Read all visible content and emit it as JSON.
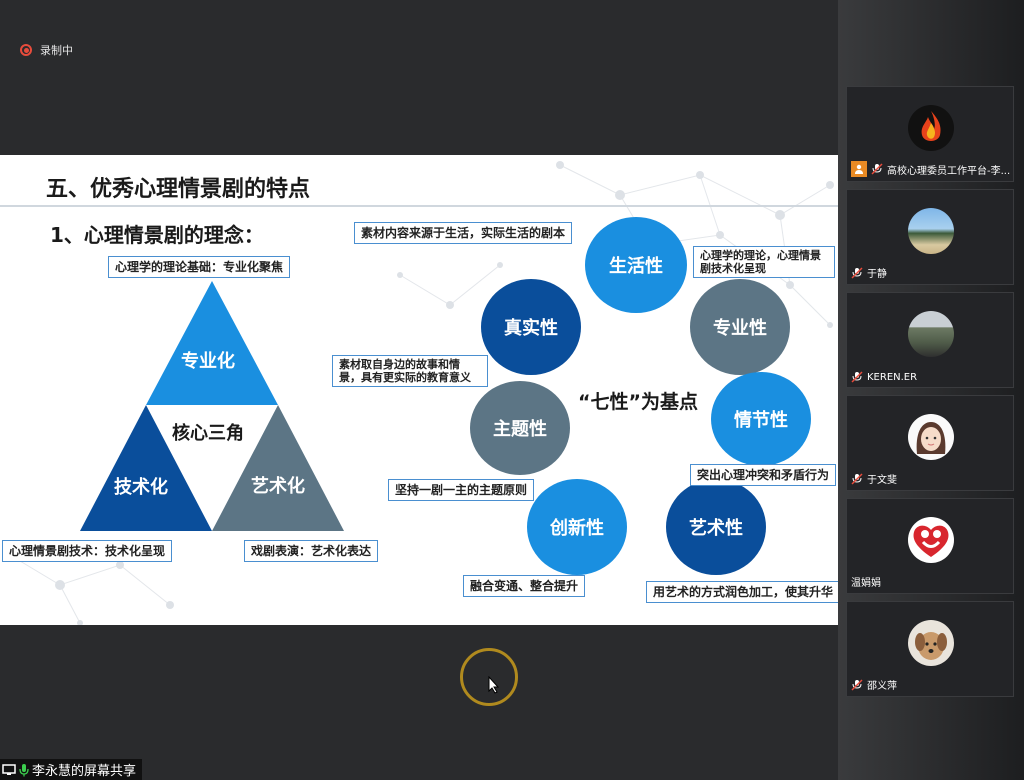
{
  "recording": {
    "label": "录制中"
  },
  "slide": {
    "title": "五、优秀心理情景剧的特点",
    "subtitle": "1、心理情景剧的理念：",
    "triangle": {
      "top_label": "心理学的理论基础：专业化聚焦",
      "top": "专业化",
      "center": "核心三角",
      "left": "技术化",
      "right": "艺术化",
      "left_label": "心理情景剧技术：技术化呈现",
      "right_label": "戏剧表演：艺术化表达"
    },
    "center_text": "“七性”为基点",
    "circles": {
      "shenghuo": "生活性",
      "zhenshi": "真实性",
      "zhuanye": "专业性",
      "zhuti": "主题性",
      "qingjie": "情节性",
      "chuangxin": "创新性",
      "yishu": "艺术性"
    },
    "notes": {
      "shenghuo": "素材内容来源于生活，实际生活的剧本",
      "zhuanye": "心理学的理论，心理情景剧技术化呈现",
      "zhenshi": "素材取自身边的故事和情景，具有更实际的教育意义",
      "zhuti": "坚持一剧一主的主题原则",
      "qingjie": "突出心理冲突和矛盾行为",
      "chuangxin": "融合变通、整合提升",
      "yishu": "用艺术的方式润色加工，使其升华"
    }
  },
  "share_bar": {
    "label": "李永慧的屏幕共享"
  },
  "participants": [
    {
      "name": "高校心理委员工作平台-李...",
      "avatar": "flame-logo-avatar",
      "host": true
    },
    {
      "name": "于静",
      "avatar": "beach-photo-avatar"
    },
    {
      "name": "KEREN.ER",
      "avatar": "building-photo-avatar"
    },
    {
      "name": "于文斐",
      "avatar": "cartoon-girl-avatar"
    },
    {
      "name": "温娟娟",
      "avatar": "heart-logo-avatar"
    },
    {
      "name": "邵义萍",
      "avatar": "dog-photo-avatar"
    }
  ],
  "colors": {
    "light_blue": "#1a8fe0",
    "dark_blue": "#0a4e9b",
    "gray": "#5c7585",
    "label_border": "#4a8fd0"
  }
}
